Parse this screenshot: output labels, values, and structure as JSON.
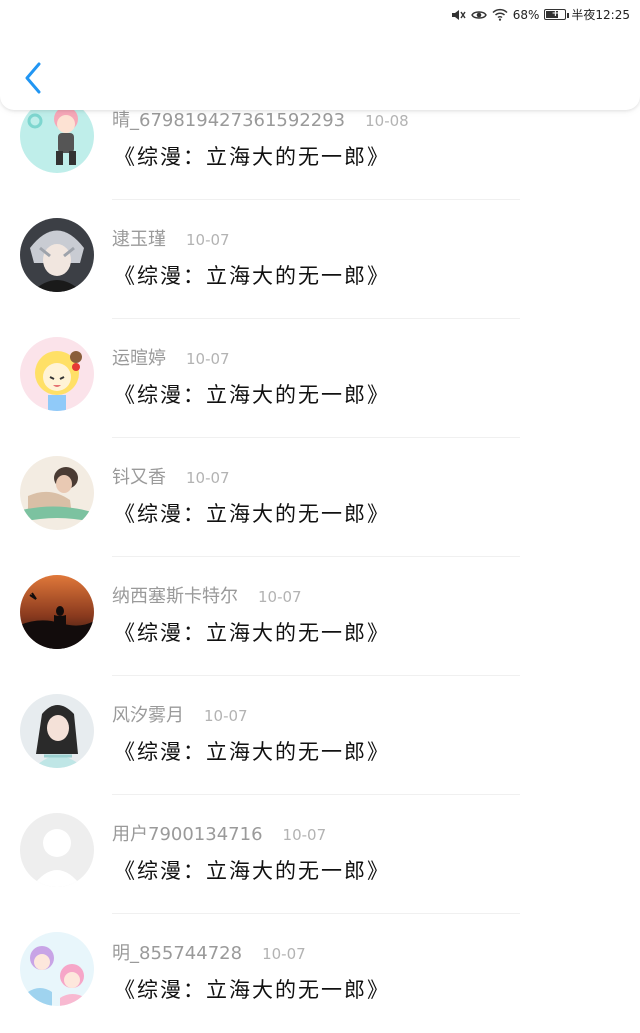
{
  "status_bar": {
    "battery": "68%",
    "battery_level": 0.68,
    "time": "半夜12:25"
  },
  "header": {
    "back_icon": "chevron-left-icon",
    "accent_color": "#2196F3"
  },
  "list": [
    {
      "name": "晴_6798194273615922​93",
      "date": "10-08",
      "title": "《综漫：立海大的无一郎》",
      "avatar": "cartoon-pink-hair"
    },
    {
      "name": "逮玉瑾",
      "date": "10-07",
      "title": "《综漫：立海大的无一郎》",
      "avatar": "anime-silver-hair"
    },
    {
      "name": "运暄婷",
      "date": "10-07",
      "title": "《综漫：立海大的无一郎》",
      "avatar": "cartoon-blonde-girl"
    },
    {
      "name": "钭又香",
      "date": "10-07",
      "title": "《综漫：立海大的无一郎》",
      "avatar": "photo-couple"
    },
    {
      "name": "纳西塞斯卡特尔",
      "date": "10-07",
      "title": "《综漫：立海大的无一郎》",
      "avatar": "sunset-silhouette"
    },
    {
      "name": "风汐雾月",
      "date": "10-07",
      "title": "《综漫：立海大的无一郎》",
      "avatar": "photo-costume"
    },
    {
      "name": "用户7900134716",
      "date": "10-07",
      "title": "《综漫：立海大的无一郎》",
      "avatar": "default-user"
    },
    {
      "name": "明_855744728",
      "date": "10-07",
      "title": "《综漫：立海大的无一郎》",
      "avatar": "cartoon-couple"
    }
  ]
}
